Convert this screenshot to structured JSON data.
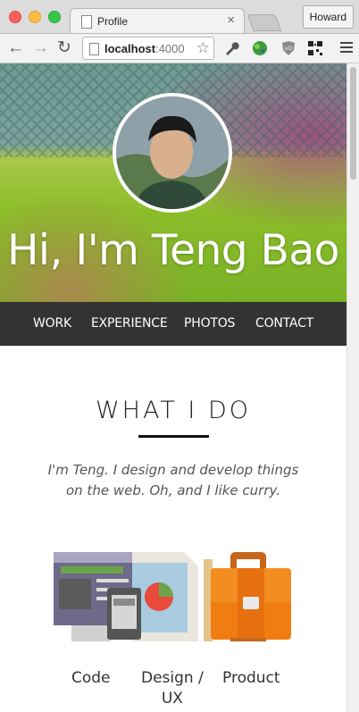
{
  "browser": {
    "tab_title": "Profile",
    "profile_name": "Howard",
    "url_host": "localhost",
    "url_port": ":4000",
    "extensions": [
      "wrench-icon",
      "globe-icon",
      "ublock-icon",
      "qr-code-icon"
    ]
  },
  "hero": {
    "greeting": "Hi, I'm Teng Bao"
  },
  "nav": {
    "items": [
      "WORK",
      "EXPERIENCE",
      "PHOTOS",
      "CONTACT"
    ]
  },
  "what_i_do": {
    "title": "WHAT I DO",
    "intro_line1": "I'm Teng. I design and develop things",
    "intro_line2": "on the web. Oh, and I like curry.",
    "skills": [
      {
        "label": "Code",
        "icon": "code-illustration"
      },
      {
        "label_line1": "Design /",
        "label_line2": "UX",
        "icon": "design-illustration"
      },
      {
        "label": "Product",
        "icon": "briefcase-illustration"
      }
    ]
  },
  "colors": {
    "nav_bg": "#333333",
    "briefcase_orange": "#f07d12",
    "accent_green": "#8bbd2a"
  }
}
